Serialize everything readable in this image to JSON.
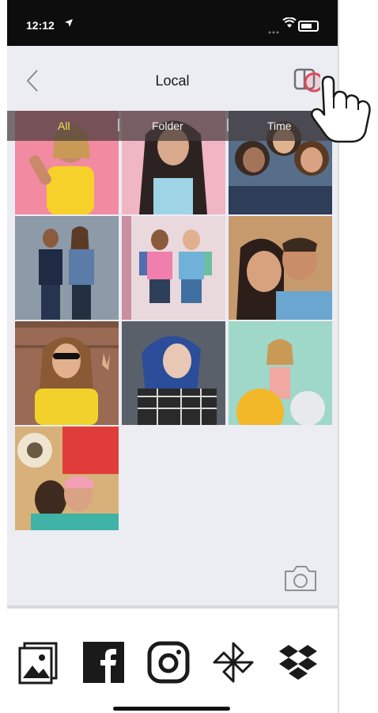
{
  "status_bar": {
    "time": "12:12"
  },
  "nav": {
    "title": "Local"
  },
  "filters": {
    "tabs": [
      {
        "label": "All",
        "active": true
      },
      {
        "label": "Folder",
        "active": false
      },
      {
        "label": "Time",
        "active": false
      }
    ]
  },
  "colors": {
    "filter_active": "#f4dd52",
    "tap_highlight": "#e0495a",
    "background": "#ececf3"
  },
  "photos": [
    {
      "description": "woman-yellow-shirt-pink-bg",
      "bg": "#f28aa2"
    },
    {
      "description": "woman-dark-hair-pink-bg",
      "bg": "#f0b6c4"
    },
    {
      "description": "three-friends-lying",
      "bg": "#566e8a"
    },
    {
      "description": "couple-denim",
      "bg": "#8d9aa8"
    },
    {
      "description": "two-girls-backpacks",
      "bg": "#e9d8dc"
    },
    {
      "description": "couple-selfie",
      "bg": "#c79a6e"
    },
    {
      "description": "woman-yellow-sweater-brick",
      "bg": "#9a6a55"
    },
    {
      "description": "woman-blue-hair-plaid",
      "bg": "#59606a"
    },
    {
      "description": "woman-balloons-teal",
      "bg": "#9fd7c9"
    },
    {
      "description": "two-women-hugging-flowers",
      "bg": "#d7b07a"
    }
  ],
  "share_targets": [
    {
      "icon": "gallery-icon"
    },
    {
      "icon": "facebook-icon"
    },
    {
      "icon": "instagram-icon"
    },
    {
      "icon": "pinwheel-icon"
    },
    {
      "icon": "dropbox-icon"
    }
  ]
}
